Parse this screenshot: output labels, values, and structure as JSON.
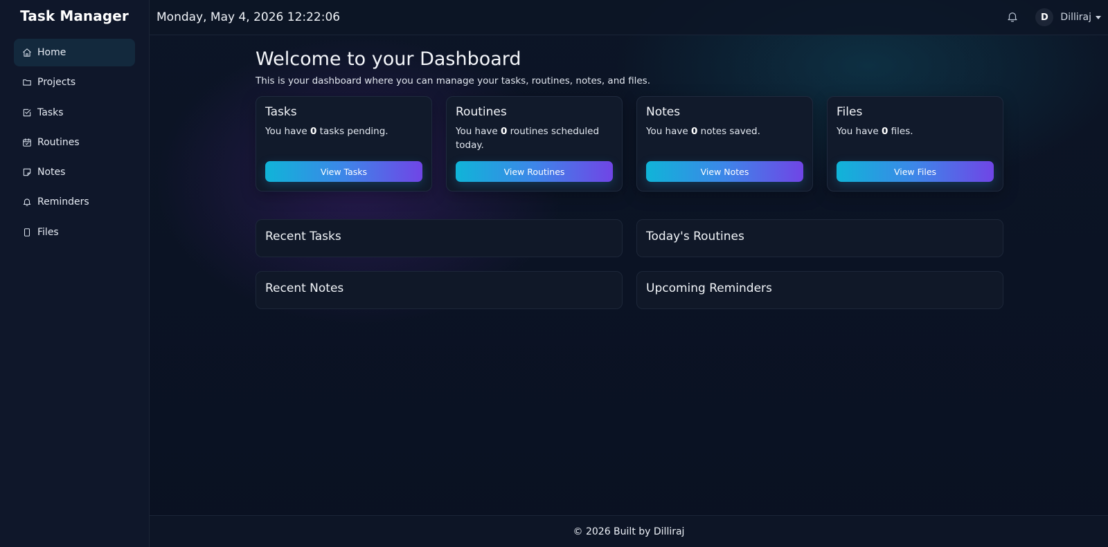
{
  "app": {
    "title": "Task Manager"
  },
  "sidebar": {
    "items": [
      {
        "label": "Home",
        "icon": "home-icon",
        "active": true
      },
      {
        "label": "Projects",
        "icon": "folder-icon",
        "active": false
      },
      {
        "label": "Tasks",
        "icon": "check-square-icon",
        "active": false
      },
      {
        "label": "Routines",
        "icon": "calendar-check-icon",
        "active": false
      },
      {
        "label": "Notes",
        "icon": "sticky-note-icon",
        "active": false
      },
      {
        "label": "Reminders",
        "icon": "bell-icon",
        "active": false
      },
      {
        "label": "Files",
        "icon": "file-icon",
        "active": false
      }
    ]
  },
  "header": {
    "datetime": "Monday, May 4, 2026 12:22:06",
    "notifications_icon": "bell-icon",
    "user": {
      "initial": "D",
      "name": "Dilliraj"
    }
  },
  "main": {
    "title": "Welcome to your Dashboard",
    "subtitle": "This is your dashboard where you can manage your tasks, routines, notes, and files.",
    "cards": [
      {
        "title": "Tasks",
        "prefix": "You have ",
        "count": "0",
        "suffix": " tasks pending.",
        "button": "View Tasks"
      },
      {
        "title": "Routines",
        "prefix": "You have ",
        "count": "0",
        "suffix": " routines scheduled today.",
        "button": "View Routines"
      },
      {
        "title": "Notes",
        "prefix": "You have ",
        "count": "0",
        "suffix": " notes saved.",
        "button": "View Notes"
      },
      {
        "title": "Files",
        "prefix": "You have ",
        "count": "0",
        "suffix": " files.",
        "button": "View Files"
      }
    ],
    "panels": [
      {
        "title": "Recent Tasks"
      },
      {
        "title": "Today's Routines"
      },
      {
        "title": "Recent Notes"
      },
      {
        "title": "Upcoming Reminders"
      }
    ]
  },
  "footer": {
    "text": "© 2026 Built by Dilliraj"
  },
  "colors": {
    "sidebar_bg": "#0f172a",
    "active_item_bg": "#13293d",
    "button_gradient_start": "#10b4d8",
    "button_gradient_end": "#7045e6"
  }
}
